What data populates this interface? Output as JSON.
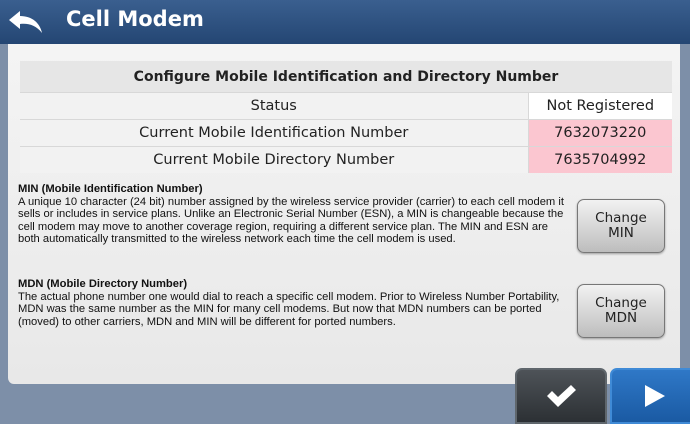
{
  "header": {
    "title": "Cell Modem",
    "back_icon": "back-arrow-icon"
  },
  "table": {
    "heading": "Configure Mobile Identification and Directory Number",
    "rows": [
      {
        "label": "Status",
        "value": "Not Registered"
      },
      {
        "label": "Current Mobile Identification Number",
        "value": "7632073220"
      },
      {
        "label": "Current Mobile Directory Number",
        "value": "7635704992"
      }
    ],
    "highlight_color": "#fbc6d0"
  },
  "min_section": {
    "title": "MIN (Mobile Identification Number)",
    "text": "A unique 10 character (24 bit) number assigned by the wireless service provider (carrier) to each cell modem it sells or includes in service plans. Unlike an Electronic Serial Number (ESN), a MIN is changeable because the cell modem may move to another coverage region, requiring a different service plan. The MIN and ESN are both automatically transmitted to the wireless network each time the cell modem is used.",
    "button_line1": "Change",
    "button_line2": "MIN"
  },
  "mdn_section": {
    "title": "MDN (Mobile Directory Number)",
    "text": "The actual phone number one would dial to reach a specific cell modem. Prior to Wireless Number Portability, MDN was the same number as the MIN for many cell modems. But now that MDN numbers can be ported (moved) to other carriers, MDN and MIN will be different for ported numbers.",
    "button_line1": "Change",
    "button_line2": "MDN"
  },
  "footer": {
    "ok_icon": "checkmark-icon",
    "next_icon": "play-arrow-icon"
  },
  "colors": {
    "header": "#2f5382",
    "next": "#2369b8"
  }
}
